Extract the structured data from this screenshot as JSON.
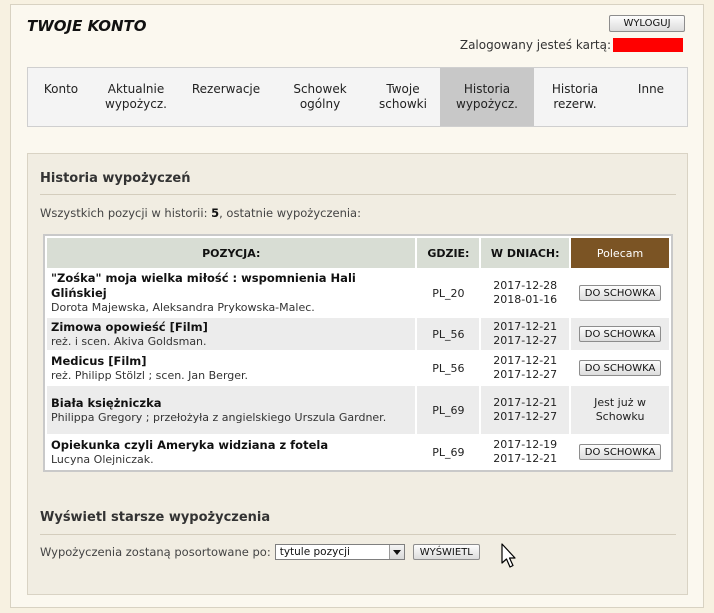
{
  "header": {
    "site_title": "TWOJE KONTO",
    "logout_label": "WYLOGUJ",
    "logged_in_label": "Zalogowany jesteś kartą:"
  },
  "nav": [
    {
      "label": "Konto",
      "active": false
    },
    {
      "label": "Aktualnie wypożycz.",
      "active": false
    },
    {
      "label": "Rezerwacje",
      "active": false
    },
    {
      "label": "Schowek ogólny",
      "active": false
    },
    {
      "label": "Twoje schowki",
      "active": false
    },
    {
      "label": "Historia wypożycz.",
      "active": true
    },
    {
      "label": "Historia rezerw.",
      "active": false
    },
    {
      "label": "Inne",
      "active": false
    }
  ],
  "history": {
    "section_title": "Historia wypożyczeń",
    "summary_prefix": "Wszystkich pozycji w historii: ",
    "summary_count": "5",
    "summary_suffix": ", ostatnie wypożyczenia:",
    "columns": {
      "position": "POZYCJA:",
      "where": "GDZIE:",
      "days": "W DNIACH:",
      "recommend": "Polecam"
    },
    "rows": [
      {
        "title": "\"Zośka\" moja wielka miłość : wspomnienia Hali Glińskiej",
        "author": "Dorota Majewska, Aleksandra Prykowska-Malec.",
        "where": "PL_20",
        "date_from": "2017-12-28",
        "date_to": "2018-01-16",
        "action_label": "DO SCHOWKA"
      },
      {
        "title": "Zimowa opowieść [Film]",
        "author": "reż. i scen. Akiva Goldsman.",
        "where": "PL_56",
        "date_from": "2017-12-21",
        "date_to": "2017-12-27",
        "action_label": "DO SCHOWKA"
      },
      {
        "title": "Medicus [Film]",
        "author": "reż. Philipp Stölzl ; scen. Jan Berger.",
        "where": "PL_56",
        "date_from": "2017-12-21",
        "date_to": "2017-12-27",
        "action_label": "DO SCHOWKA"
      },
      {
        "title": "Biała księżniczka",
        "author": "Philippa Gregory ; przełożyła z angielskiego Urszula Gardner.",
        "where": "PL_69",
        "date_from": "2017-12-21",
        "date_to": "2017-12-27",
        "action_label": "",
        "status_note": "Jest już w Schowku"
      },
      {
        "title": "Opiekunka czyli Ameryka widziana z fotela",
        "author": "Lucyna Olejniczak.",
        "where": "PL_69",
        "date_from": "2017-12-19",
        "date_to": "2017-12-21",
        "action_label": "DO SCHOWKA"
      }
    ]
  },
  "older": {
    "section_title": "Wyświetl starsze wypożyczenia",
    "sort_label": "Wypożyczenia zostaną posortowane po:",
    "sort_selected": "tytule pozycji",
    "show_label": "WYŚWIETL"
  },
  "colors": {
    "recommend_header": "#7b5424",
    "active_tab": "#c8c8c8",
    "card_mask": "#ff0000"
  },
  "icons": {
    "select_arrow": "chevron-down-icon",
    "cursor": "mouse-pointer-icon"
  }
}
